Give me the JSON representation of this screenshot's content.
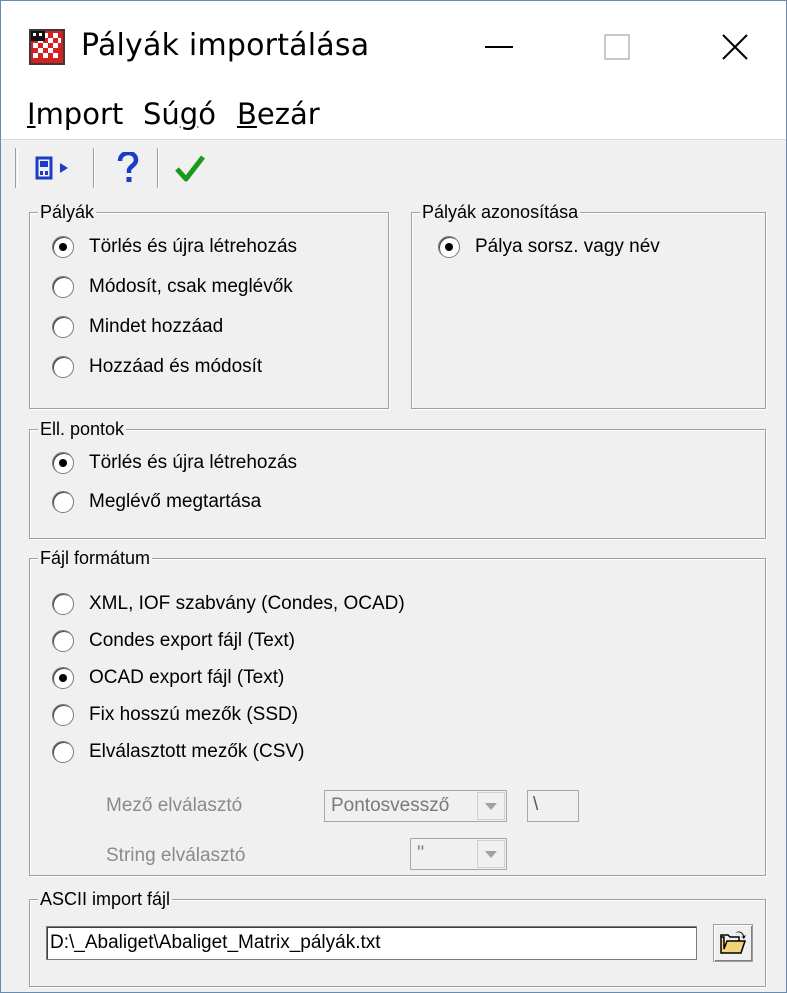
{
  "window": {
    "title": "Pályák importálása",
    "app_icon": "checkered-flag-icon",
    "caption_buttons": [
      "minimize-icon",
      "maximize-icon",
      "close-icon"
    ]
  },
  "menu": {
    "items": [
      {
        "label": "Import",
        "accel": "I"
      },
      {
        "label": "Súgó",
        "accel": "g"
      },
      {
        "label": "Bezár",
        "accel": "B"
      }
    ]
  },
  "toolbar": {
    "buttons": [
      "exit-door-icon",
      "help-question-icon",
      "ok-checkmark-icon"
    ]
  },
  "palyak": {
    "title": "Pályák",
    "options": [
      {
        "label": "Törlés és újra létrehozás",
        "checked": true
      },
      {
        "label": "Módosít, csak meglévők",
        "checked": false
      },
      {
        "label": "Mindet hozzáad",
        "checked": false
      },
      {
        "label": "Hozzáad és módosít",
        "checked": false
      }
    ]
  },
  "azonositas": {
    "title": "Pályák azonosítása",
    "options": [
      {
        "label": "Pálya sorsz. vagy név",
        "checked": true
      }
    ]
  },
  "ell_pontok": {
    "title": "Ell. pontok",
    "options": [
      {
        "label": "Törlés és újra létrehozás",
        "checked": true
      },
      {
        "label": "Meglévő megtartása",
        "checked": false
      }
    ]
  },
  "fajl_formatum": {
    "title": "Fájl formátum",
    "options": [
      {
        "label": "XML, IOF szabvány (Condes, OCAD)",
        "checked": false
      },
      {
        "label": "Condes export fájl (Text)",
        "checked": false
      },
      {
        "label": "OCAD export fájl (Text)",
        "checked": true
      },
      {
        "label": "Fix hosszú mezők (SSD)",
        "checked": false
      },
      {
        "label": "Elválasztott mezők (CSV)",
        "checked": false
      }
    ],
    "mezo_elvalaszto": {
      "label": "Mező elválasztó",
      "value": "Pontosvessző",
      "extra": "\\"
    },
    "string_elvalaszto": {
      "label": "String elválasztó",
      "value": "''"
    }
  },
  "ascii": {
    "title": "ASCII import fájl",
    "path": "D:\\_Abaliget\\Abaliget_Matrix_pályák.txt",
    "browse_icon": "open-folder-icon"
  },
  "colors": {
    "window_bg": "#f0f0f0",
    "title_bg": "#ffffff",
    "check_green": "#1a9a1a",
    "toolbar_blue": "#1c3cc8"
  }
}
